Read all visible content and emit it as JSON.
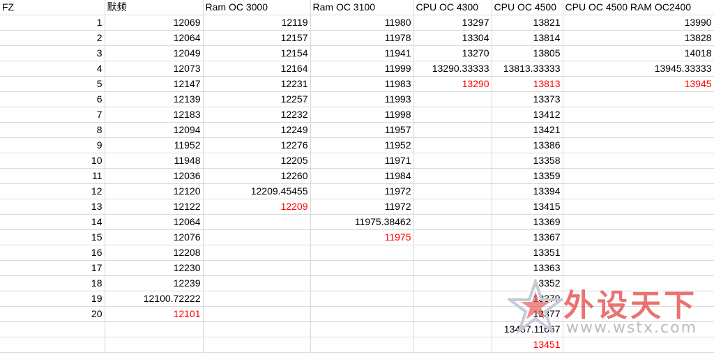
{
  "sheet": {
    "headers": [
      "FZ",
      "默频",
      "Ram OC 3000",
      "Ram OC 3100",
      "CPU OC 4300",
      "CPU OC 4500",
      "CPU OC 4500  RAM OC2400"
    ],
    "rows": [
      {
        "fz": "1",
        "stock": "12069",
        "ram3000": "12119",
        "ram3100": "11980",
        "cpu4300": "13297",
        "cpu4500": "13821",
        "cpu4500ram": "13990"
      },
      {
        "fz": "2",
        "stock": "12064",
        "ram3000": "12157",
        "ram3100": "11978",
        "cpu4300": "13304",
        "cpu4500": "13814",
        "cpu4500ram": "13828"
      },
      {
        "fz": "3",
        "stock": "12049",
        "ram3000": "12154",
        "ram3100": "11941",
        "cpu4300": "13270",
        "cpu4500": "13805",
        "cpu4500ram": "14018"
      },
      {
        "fz": "4",
        "stock": "12073",
        "ram3000": "12164",
        "ram3100": "11999",
        "cpu4300": "13290.33333",
        "cpu4500": "13813.33333",
        "cpu4500ram": "13945.33333"
      },
      {
        "fz": "5",
        "stock": "12147",
        "ram3000": "12231",
        "ram3100": "11983",
        "cpu4300": "13290",
        "cpu4500": "13813",
        "cpu4500ram": "13945"
      },
      {
        "fz": "6",
        "stock": "12139",
        "ram3000": "12257",
        "ram3100": "11993",
        "cpu4300": "",
        "cpu4500": "13373",
        "cpu4500ram": ""
      },
      {
        "fz": "7",
        "stock": "12183",
        "ram3000": "12232",
        "ram3100": "11998",
        "cpu4300": "",
        "cpu4500": "13412",
        "cpu4500ram": ""
      },
      {
        "fz": "8",
        "stock": "12094",
        "ram3000": "12249",
        "ram3100": "11957",
        "cpu4300": "",
        "cpu4500": "13421",
        "cpu4500ram": ""
      },
      {
        "fz": "9",
        "stock": "11952",
        "ram3000": "12276",
        "ram3100": "11952",
        "cpu4300": "",
        "cpu4500": "13386",
        "cpu4500ram": ""
      },
      {
        "fz": "10",
        "stock": "11948",
        "ram3000": "12205",
        "ram3100": "11971",
        "cpu4300": "",
        "cpu4500": "13358",
        "cpu4500ram": ""
      },
      {
        "fz": "11",
        "stock": "12036",
        "ram3000": "12260",
        "ram3100": "11984",
        "cpu4300": "",
        "cpu4500": "13359",
        "cpu4500ram": ""
      },
      {
        "fz": "12",
        "stock": "12120",
        "ram3000": "12209.45455",
        "ram3100": "11972",
        "cpu4300": "",
        "cpu4500": "13394",
        "cpu4500ram": ""
      },
      {
        "fz": "13",
        "stock": "12122",
        "ram3000": "12209",
        "ram3100": "11972",
        "cpu4300": "",
        "cpu4500": "13415",
        "cpu4500ram": ""
      },
      {
        "fz": "14",
        "stock": "12064",
        "ram3000": "",
        "ram3100": "11975.38462",
        "cpu4300": "",
        "cpu4500": "13369",
        "cpu4500ram": ""
      },
      {
        "fz": "15",
        "stock": "12076",
        "ram3000": "",
        "ram3100": "11975",
        "cpu4300": "",
        "cpu4500": "13367",
        "cpu4500ram": ""
      },
      {
        "fz": "16",
        "stock": "12208",
        "ram3000": "",
        "ram3100": "",
        "cpu4300": "",
        "cpu4500": "13351",
        "cpu4500ram": ""
      },
      {
        "fz": "17",
        "stock": "12230",
        "ram3000": "",
        "ram3100": "",
        "cpu4300": "",
        "cpu4500": "13363",
        "cpu4500ram": ""
      },
      {
        "fz": "18",
        "stock": "12239",
        "ram3000": "",
        "ram3100": "",
        "cpu4300": "",
        "cpu4500": "13352",
        "cpu4500ram": ""
      },
      {
        "fz": "19",
        "stock": "12100.72222",
        "ram3000": "",
        "ram3100": "",
        "cpu4300": "",
        "cpu4500": "13379",
        "cpu4500ram": ""
      },
      {
        "fz": "20",
        "stock": "12101",
        "ram3000": "",
        "ram3100": "",
        "cpu4300": "",
        "cpu4500": "13377",
        "cpu4500ram": ""
      },
      {
        "fz": "",
        "stock": "",
        "ram3000": "",
        "ram3100": "",
        "cpu4300": "",
        "cpu4500": "13487.11667",
        "cpu4500ram": ""
      },
      {
        "fz": "",
        "stock": "",
        "ram3000": "",
        "ram3100": "",
        "cpu4300": "",
        "cpu4500": "13451",
        "cpu4500ram": ""
      }
    ],
    "red_cells": {
      "stock": 19,
      "ram3000": 12,
      "ram3100": 14,
      "cpu4300": 4,
      "cpu4500": [
        4,
        21
      ],
      "cpu4500ram": 4
    },
    "highlight_color": "#ff0000"
  },
  "watermark": {
    "text": "外设天下",
    "url": "www.wstx.com",
    "star_icon": "star-logo-icon"
  }
}
